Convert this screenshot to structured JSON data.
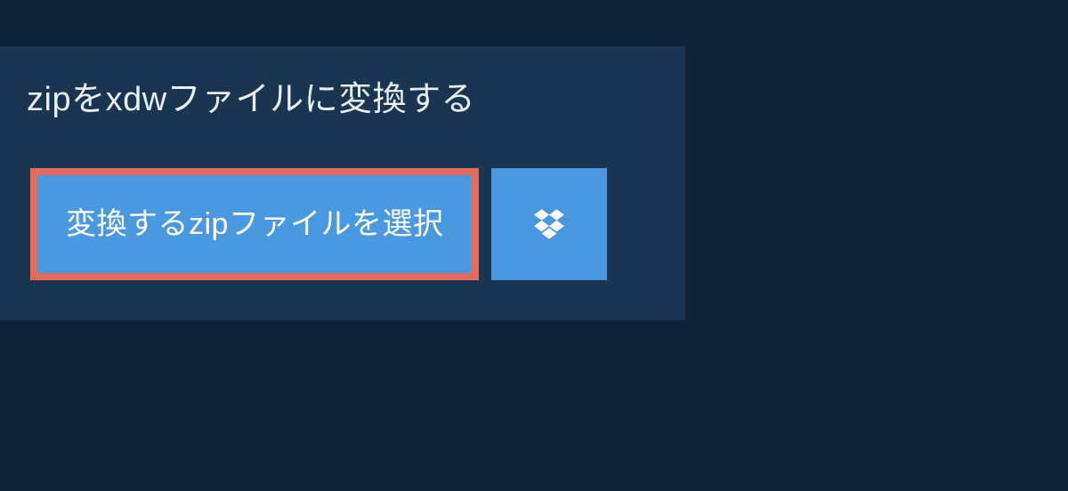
{
  "heading": "zipをxdwファイルに変換する",
  "select_button_label": "変換するzipファイルを選択",
  "colors": {
    "page_bg": "#0f2238",
    "panel_bg": "#1a3552",
    "button_bg": "#4a99e0",
    "button_border": "#e86a5a",
    "text": "#ffffff"
  }
}
